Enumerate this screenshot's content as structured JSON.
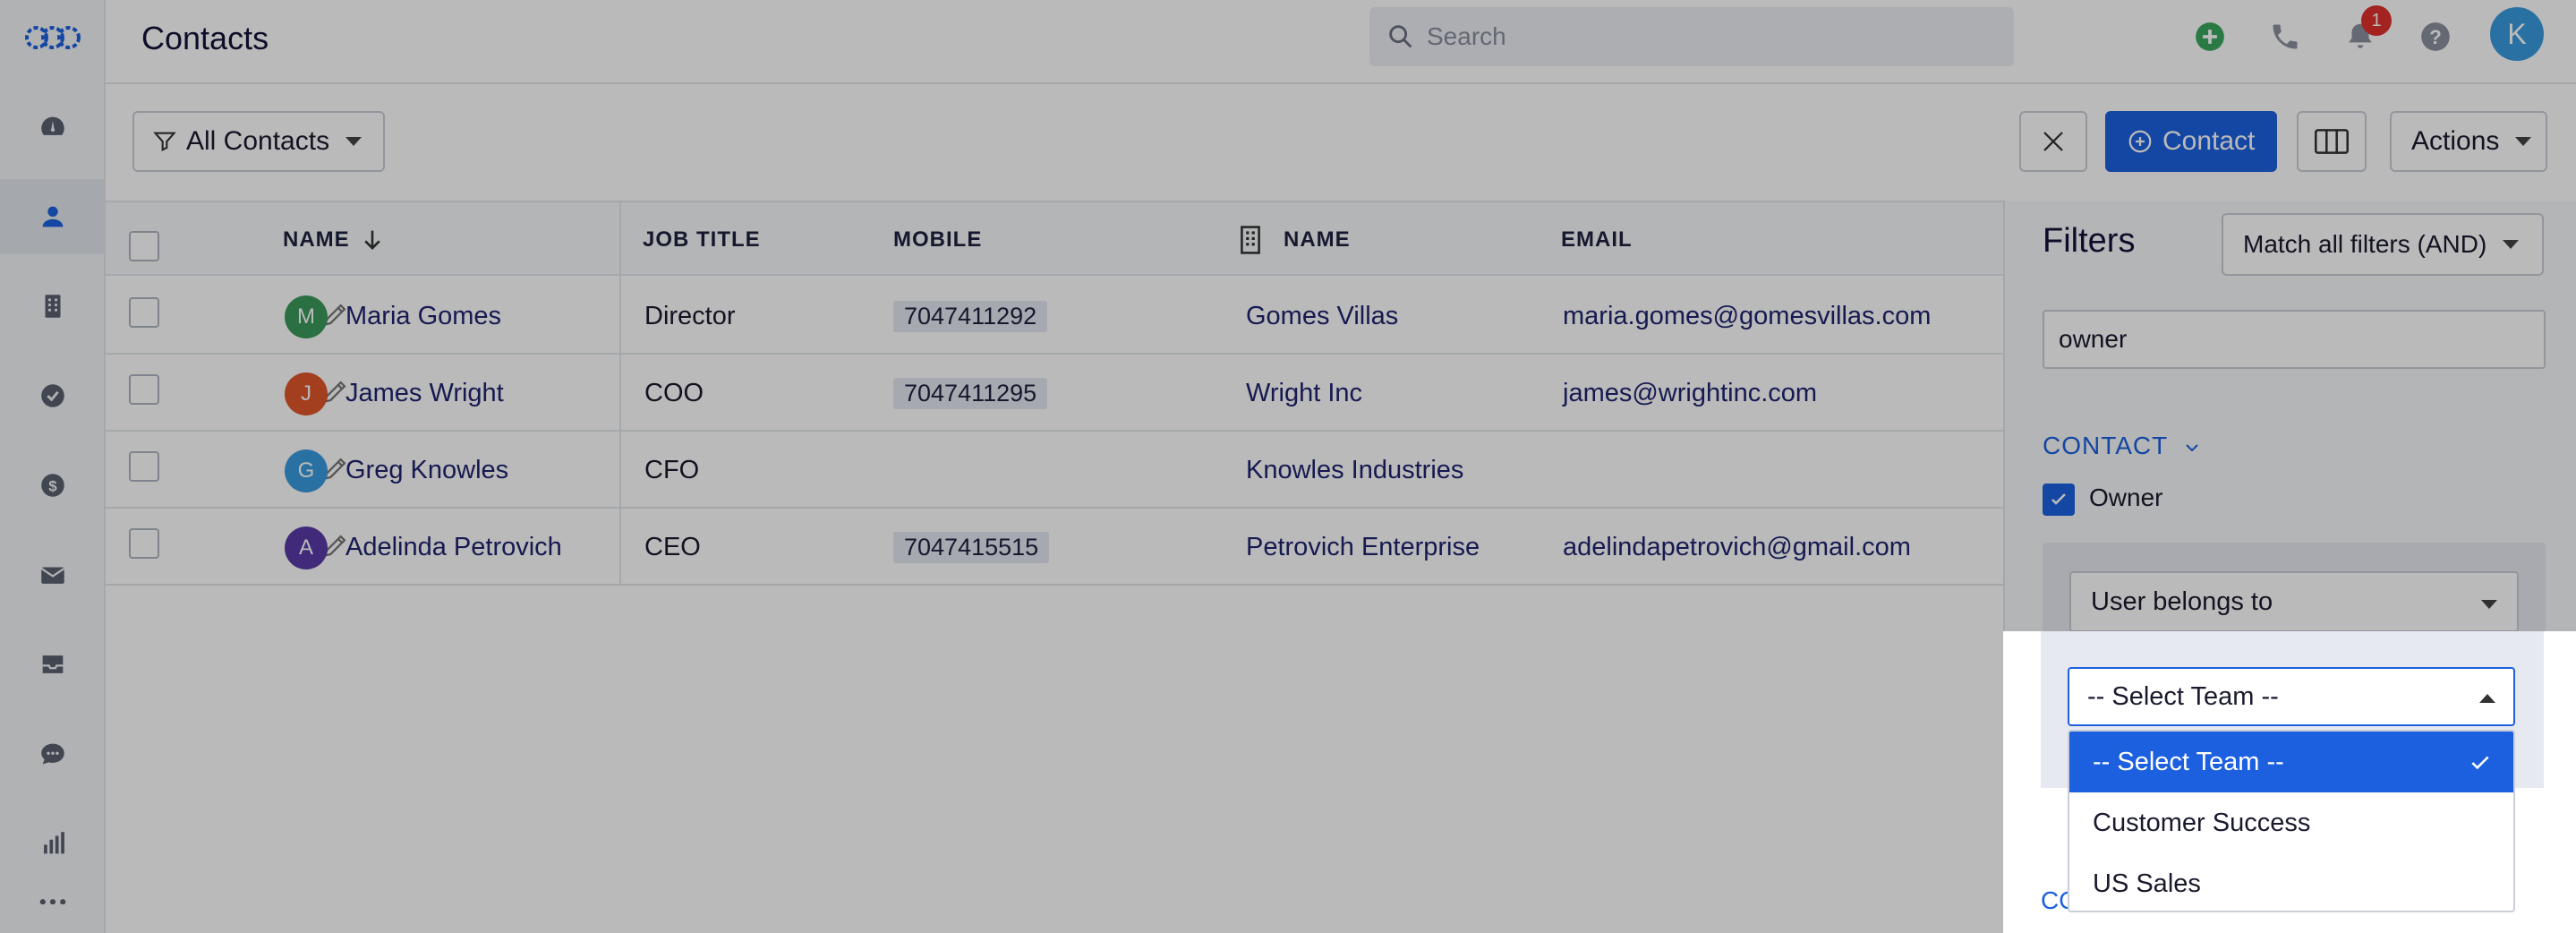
{
  "header": {
    "title": "Contacts",
    "search_placeholder": "Search",
    "notification_count": "1",
    "avatar_initial": "K"
  },
  "toolbar": {
    "view_label": "All Contacts",
    "add_contact_label": "Contact",
    "actions_label": "Actions"
  },
  "table": {
    "columns": [
      "NAME",
      "JOB TITLE",
      "MOBILE",
      "NAME",
      "EMAIL"
    ],
    "rows": [
      {
        "initial": "M",
        "avatar_color": "#3a9a5c",
        "name": "Maria Gomes",
        "job": "Director",
        "mobile": "7047411292",
        "company": "Gomes Villas",
        "email": "maria.gomes@gomesvillas.com"
      },
      {
        "initial": "J",
        "avatar_color": "#e0552a",
        "name": "James Wright",
        "job": "COO",
        "mobile": "7047411295",
        "company": "Wright Inc",
        "email": "james@wrightinc.com"
      },
      {
        "initial": "G",
        "avatar_color": "#3a9be0",
        "name": "Greg Knowles",
        "job": "CFO",
        "mobile": "",
        "company": "Knowles Industries",
        "email": ""
      },
      {
        "initial": "A",
        "avatar_color": "#5a3aa8",
        "name": "Adelinda Petrovich",
        "job": "CEO",
        "mobile": "7047415515",
        "company": "Petrovich Enterprise",
        "email": "adelindapetrovich@gmail.com"
      }
    ]
  },
  "filters": {
    "title": "Filters",
    "match_mode": "Match all filters (AND)",
    "search_value": "owner",
    "section": "CONTACT",
    "owner_label": "Owner",
    "condition": "User belongs to",
    "team_select_value": "-- Select Team --",
    "team_options": [
      "-- Select Team --",
      "Customer Success",
      "US Sales"
    ],
    "footer_link": "CO"
  },
  "colors": {
    "accent": "#1c60e0",
    "badge": "#e0302c"
  }
}
